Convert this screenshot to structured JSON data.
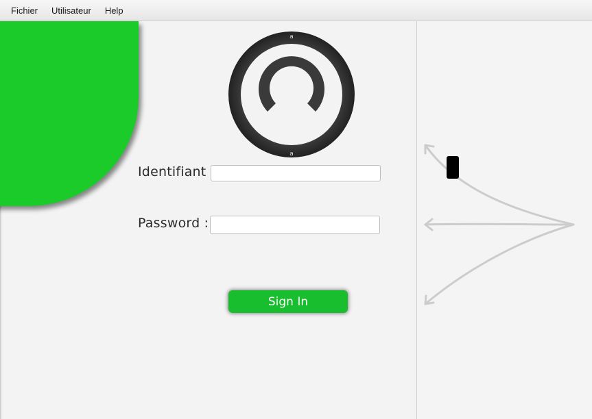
{
  "menubar": {
    "items": [
      "Fichier",
      "Utilisateur",
      "Help"
    ]
  },
  "login": {
    "identifiant_label": "Identifiant",
    "identifiant_value": "",
    "password_label": "Password :",
    "password_value": "",
    "signin_label": "Sign In"
  },
  "avatar": {
    "icon": "user-avatar-icon",
    "top_mark": "a",
    "bottom_mark": "a"
  },
  "colors": {
    "brand_green": "#1bcb2a",
    "button_green": "#19be2f",
    "ring_dark": "#333333",
    "arrow_gray": "#cccccc"
  },
  "decor": {
    "icons": [
      "arrow-up-left-icon",
      "arrow-left-icon",
      "arrow-down-left-icon",
      "phone-icon"
    ]
  }
}
